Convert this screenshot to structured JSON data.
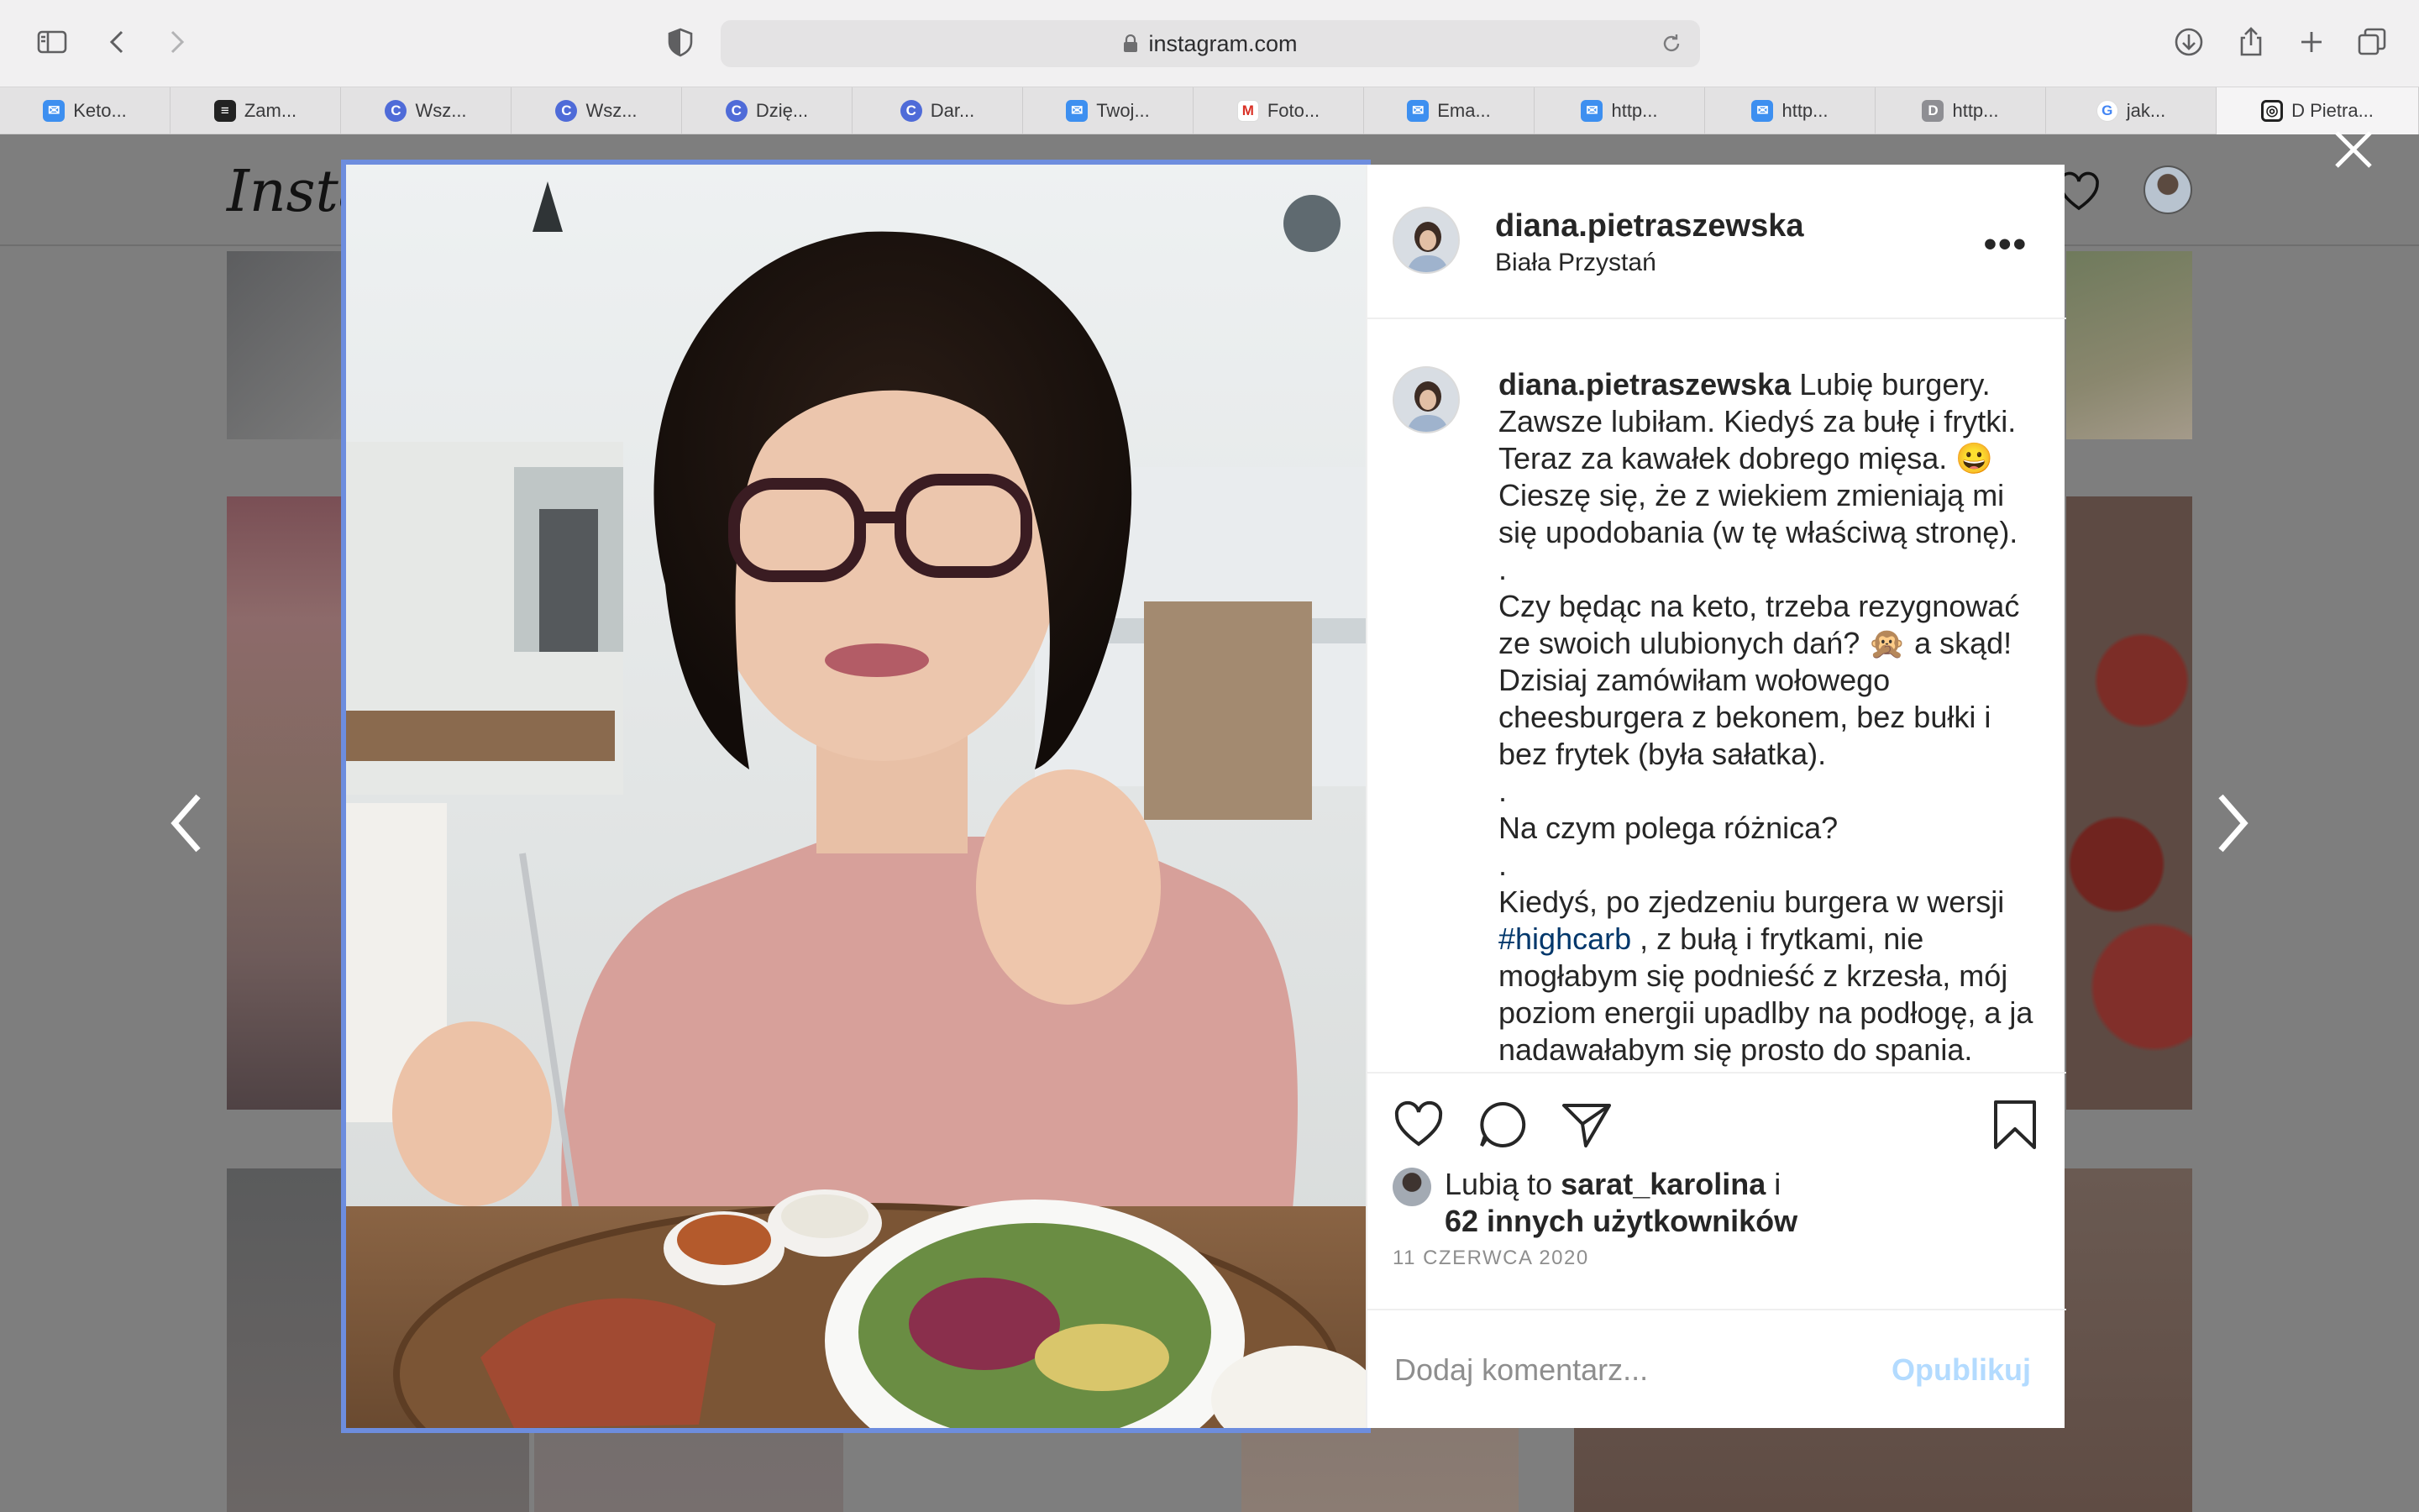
{
  "browser": {
    "url": "instagram.com",
    "tabs": [
      {
        "label": "Keto...",
        "icon": "mail-icon"
      },
      {
        "label": "Zam...",
        "icon": "stack-icon"
      },
      {
        "label": "Wsz...",
        "icon": "c-icon"
      },
      {
        "label": "Wsz...",
        "icon": "c-icon"
      },
      {
        "label": "Dzię...",
        "icon": "c-icon"
      },
      {
        "label": "Dar...",
        "icon": "c-icon"
      },
      {
        "label": "Twoj...",
        "icon": "mail-icon"
      },
      {
        "label": "Foto...",
        "icon": "gmail-icon"
      },
      {
        "label": "Ema...",
        "icon": "mail-icon"
      },
      {
        "label": "http...",
        "icon": "mail-icon"
      },
      {
        "label": "http...",
        "icon": "mail-icon"
      },
      {
        "label": "http...",
        "icon": "d-icon"
      },
      {
        "label": "jak...",
        "icon": "google-icon"
      },
      {
        "label": "D Pietra...",
        "icon": "instagram-icon"
      }
    ]
  },
  "page": {
    "logo": "Instagram"
  },
  "post": {
    "username": "diana.pietraszewska",
    "location": "Biała Przystań",
    "more": "•••",
    "caption": {
      "author": "diana.pietraszewska",
      "line1": "Lubię burgery. Zawsze lubiłam. Kiedyś za bułę i frytki. Teraz za kawałek dobrego mięsa. 😀 Cieszę się, że z wiekiem zmieniają mi się upodobania (w tę właściwą stronę).",
      "dot1": ".",
      "para2": "Czy będąc na keto, trzeba rezygnować ze swoich ulubionych dań? 🙊 a skąd! Dzisiaj zamówiłam wołowego cheesburgera z bekonem, bez bułki i bez frytek (była sałatka).",
      "dot2": ".",
      "para3": "Na czym polega różnica?",
      "dot3": ".",
      "para4_start": "Kiedyś, po zjedzeniu burgera w wersji",
      "hashtag": "#highcarb",
      "para4_end": ", z bułą i frytkami, nie mogłabym się podnieść z krzesła, mój poziom energii upadlby na podłogę, a ja nadawałabym się prosto do spania."
    },
    "likes": {
      "prefix": "Lubią to",
      "user": "sarat_karolina",
      "conj": "i",
      "others": "62 innych użytkowników"
    },
    "date": "11 CZERWCA 2020",
    "comment_placeholder": "Dodaj komentarz...",
    "publish_label": "Opublikuj"
  },
  "colors": {
    "accent_link": "#00376b",
    "publish_disabled": "#b3dbff",
    "selection_outline": "#6d8dde"
  }
}
